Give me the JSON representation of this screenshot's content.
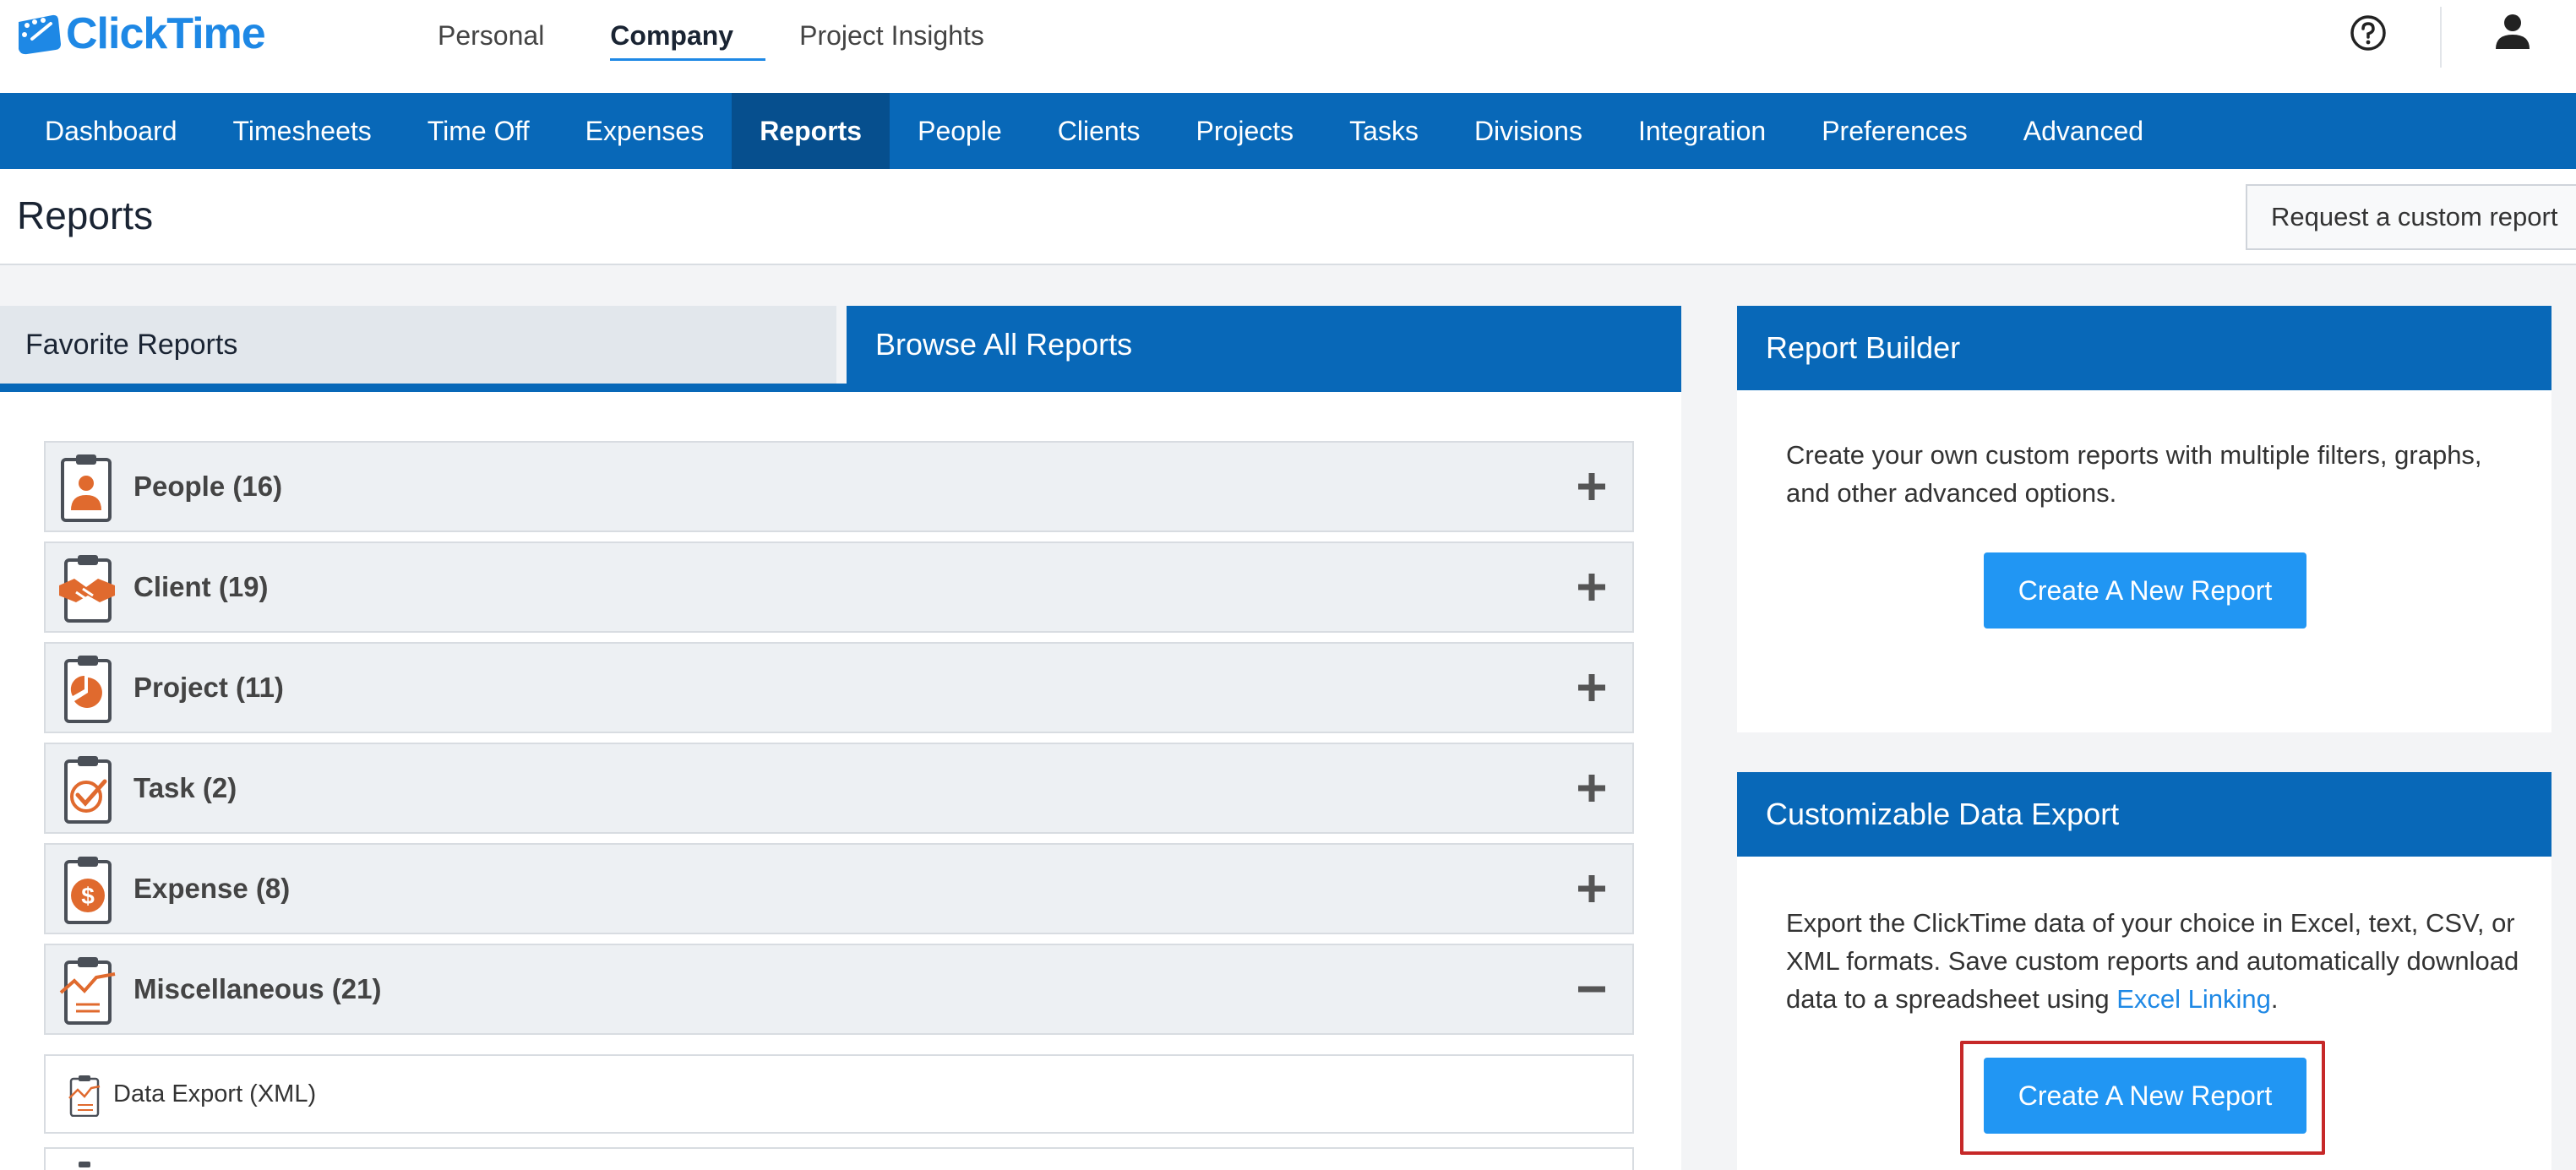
{
  "app": {
    "brand": "ClickTime",
    "brand_color": "#1e88e5",
    "nav_color": "#0868b8"
  },
  "topnav": [
    {
      "label": "Personal",
      "active": false
    },
    {
      "label": "Company",
      "active": true
    },
    {
      "label": "Project Insights",
      "active": false
    }
  ],
  "mainnav": [
    {
      "label": "Dashboard"
    },
    {
      "label": "Timesheets"
    },
    {
      "label": "Time Off"
    },
    {
      "label": "Expenses"
    },
    {
      "label": "Reports",
      "active": true
    },
    {
      "label": "People"
    },
    {
      "label": "Clients"
    },
    {
      "label": "Projects"
    },
    {
      "label": "Tasks"
    },
    {
      "label": "Divisions"
    },
    {
      "label": "Integration"
    },
    {
      "label": "Preferences"
    },
    {
      "label": "Advanced"
    }
  ],
  "page": {
    "title": "Reports",
    "custom_report_button": "Request a custom report"
  },
  "tabs": {
    "favorite": "Favorite Reports",
    "browse": "Browse All Reports"
  },
  "categories": [
    {
      "label": "People (16)",
      "icon": "person-clipboard-icon",
      "expanded": false
    },
    {
      "label": "Client (19)",
      "icon": "handshake-clipboard-icon",
      "expanded": false
    },
    {
      "label": "Project (11)",
      "icon": "pie-clipboard-icon",
      "expanded": false
    },
    {
      "label": "Task (2)",
      "icon": "checkmark-clipboard-icon",
      "expanded": false
    },
    {
      "label": "Expense (8)",
      "icon": "dollar-clipboard-icon",
      "expanded": false
    },
    {
      "label": "Miscellaneous (21)",
      "icon": "chart-clipboard-icon",
      "expanded": true
    }
  ],
  "misc_items": [
    {
      "label": "Data Export (XML)"
    }
  ],
  "report_builder": {
    "title": "Report Builder",
    "text": "Create your own custom reports with multiple filters, graphs, and other advanced options.",
    "button": "Create A New Report"
  },
  "data_export": {
    "title": "Customizable Data Export",
    "text": "Export the ClickTime data of your choice in Excel, text, CSV, or XML formats. Save custom reports and automatically download data to a spreadsheet using ",
    "link": "Excel Linking",
    "text_end": ".",
    "button": "Create A New Report"
  }
}
